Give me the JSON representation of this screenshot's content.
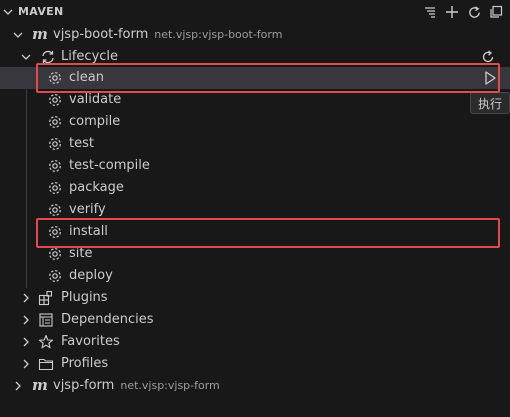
{
  "panel": {
    "title": "MAVEN"
  },
  "project1": {
    "name": "vjsp-boot-form",
    "gav": "net.vjsp:vjsp-boot-form"
  },
  "lifecycle": {
    "label": "Lifecycle"
  },
  "phases": [
    "clean",
    "validate",
    "compile",
    "test",
    "test-compile",
    "package",
    "verify",
    "install",
    "site",
    "deploy"
  ],
  "groups": {
    "plugins": "Plugins",
    "dependencies": "Dependencies",
    "favorites": "Favorites",
    "profiles": "Profiles"
  },
  "project2": {
    "name": "vjsp-form",
    "gav": "net.vjsp:vjsp-form"
  },
  "tooltip": {
    "run": "执行"
  },
  "icons": {
    "header": [
      "collapse-all-icon",
      "add-icon",
      "refresh-icon",
      "new-window-icon"
    ],
    "phase": "gear-icon",
    "run": "play-icon"
  },
  "colors": {
    "highlight_box": "#e5484d",
    "selection": "#37373d"
  }
}
